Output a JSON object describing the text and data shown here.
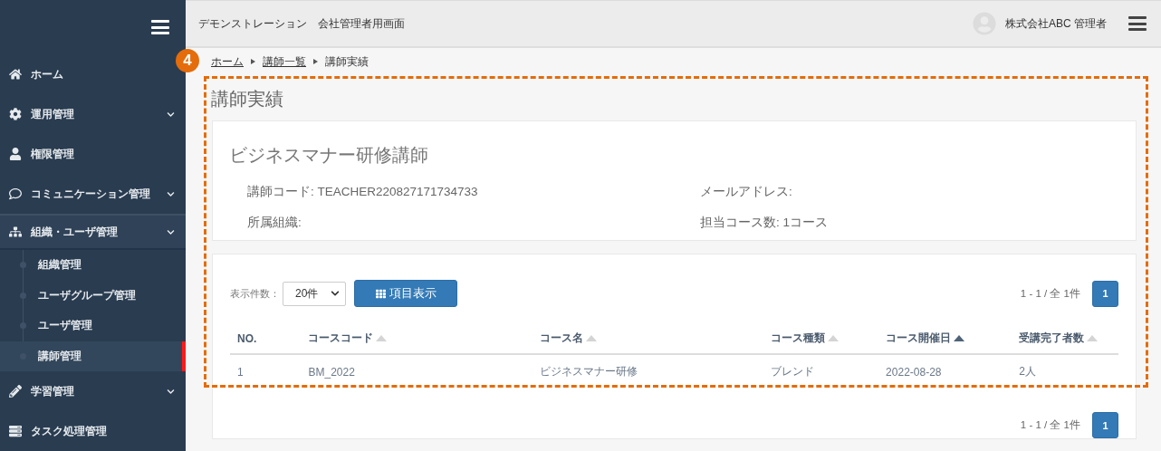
{
  "sidebar": {
    "items": [
      {
        "label": "ホーム",
        "has_submenu": false,
        "expanded": false
      },
      {
        "label": "運用管理",
        "has_submenu": true,
        "expanded": false
      },
      {
        "label": "権限管理",
        "has_submenu": false,
        "expanded": false
      },
      {
        "label": "コミュニケーション管理",
        "has_submenu": true,
        "expanded": false
      },
      {
        "label": "組織・ユーザ管理",
        "has_submenu": true,
        "expanded": true,
        "children": [
          {
            "label": "組織管理",
            "selected": false
          },
          {
            "label": "ユーザグループ管理",
            "selected": false
          },
          {
            "label": "ユーザ管理",
            "selected": false
          },
          {
            "label": "講師管理",
            "selected": true
          }
        ]
      },
      {
        "label": "学習管理",
        "has_submenu": true,
        "expanded": false
      },
      {
        "label": "タスク処理管理",
        "has_submenu": false,
        "expanded": false
      }
    ]
  },
  "header": {
    "title": "デモンストレーション　会社管理者用画面",
    "user": "株式会社ABC 管理者"
  },
  "annotation": {
    "number": "4"
  },
  "breadcrumb": [
    {
      "label": "ホーム",
      "link": true
    },
    {
      "label": "講師一覧",
      "link": true
    },
    {
      "label": "講師実績",
      "link": false
    }
  ],
  "page_title": "講師実績",
  "profile": {
    "name": "ビジネスマナー研修講師",
    "fields": [
      {
        "label": "講師コード: TEACHER220827171734733"
      },
      {
        "label": "メールアドレス:"
      },
      {
        "label": "所属組織:"
      },
      {
        "label": "担当コース数: 1コース"
      }
    ]
  },
  "list": {
    "page_size_label": "表示件数：",
    "page_size": "20件",
    "columns_button": "項目表示",
    "pagination_top": {
      "summary": "1 - 1 / 全 1件",
      "pages": [
        {
          "label": "1",
          "selected": true
        }
      ]
    },
    "columns": [
      {
        "label": "NO.",
        "sortable": false,
        "sorted": false
      },
      {
        "label": "コースコード",
        "sortable": true,
        "sorted": false
      },
      {
        "label": "コース名",
        "sortable": true,
        "sorted": false
      },
      {
        "label": "コース種類",
        "sortable": true,
        "sorted": false
      },
      {
        "label": "コース開催日",
        "sortable": true,
        "sorted": true
      },
      {
        "label": "受講完了者数",
        "sortable": true,
        "sorted": false
      }
    ],
    "rows": [
      [
        "1",
        "BM_2022",
        "ビジネスマナー研修",
        "ブレンド",
        "2022-08-28",
        "2人"
      ]
    ],
    "pagination_bottom": {
      "summary": "1 - 1 / 全 1件",
      "pages": [
        {
          "label": "1",
          "selected": true
        }
      ]
    }
  }
}
